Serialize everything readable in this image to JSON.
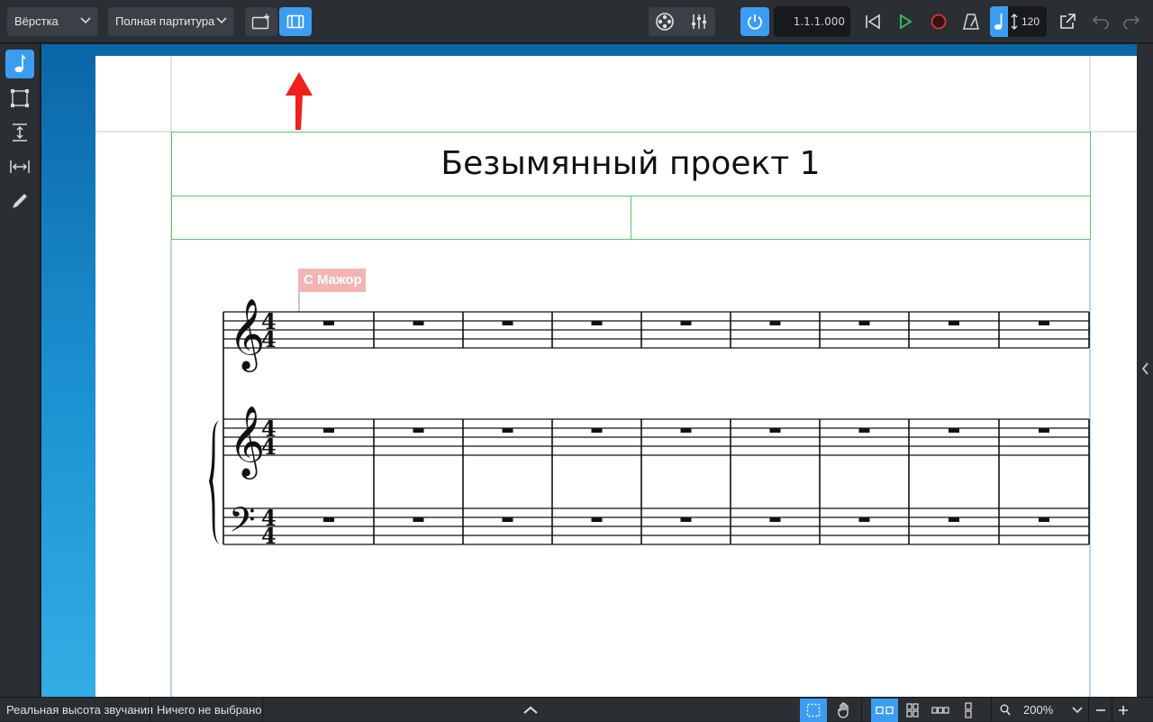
{
  "toolbar": {
    "workspace": "Вёрстка",
    "view_mode": "Полная партитура",
    "timecode": "1.1.1.000",
    "tempo": "120"
  },
  "score": {
    "title": "Безымянный проект 1",
    "key_signature": "C Мажор"
  },
  "statusbar": {
    "pitch_mode": "Реальная высота звучания",
    "selection": "Ничего не выбрано",
    "zoom": "200%"
  },
  "colors": {
    "accent": "#3b9df2",
    "frame": "#5cc46a",
    "key_signature_bg": "#f4b4b4",
    "annotation_arrow": "#f0201a"
  }
}
